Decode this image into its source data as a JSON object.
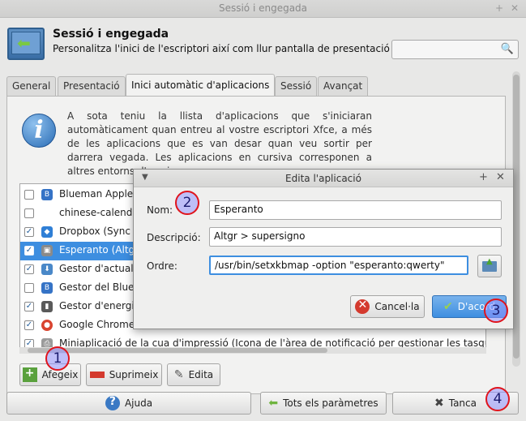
{
  "window": {
    "title": "Sessió i engegada"
  },
  "header": {
    "title": "Sessió i engegada",
    "subtitle": "Personalitza l'inici de l'escriptori així com llur pantalla de presentació",
    "search_placeholder": ""
  },
  "tabs": [
    {
      "label": "General"
    },
    {
      "label": "Presentació"
    },
    {
      "label": "Inici automàtic d'aplicacions"
    },
    {
      "label": "Sessió"
    },
    {
      "label": "Avançat"
    }
  ],
  "info_text": "A sota teniu la llista d'aplicacions que s'iniciaran automàticament quan entreu al vostre escriptori Xfce, a més de les aplicacions que es van desar quan veu sortir per darrera vegada. Les aplicacions en cursiva corresponen a altres entorns d'escri",
  "apps": [
    {
      "name": "Blueman Applet",
      "checked": false
    },
    {
      "name": "chinese-calenda",
      "checked": false
    },
    {
      "name": "Dropbox (Sync",
      "checked": true
    },
    {
      "name": "Esperanto (Altg",
      "checked": true,
      "selected": true
    },
    {
      "name": "Gestor d'actual",
      "checked": true
    },
    {
      "name": "Gestor del Blue",
      "checked": false
    },
    {
      "name": "Gestor d'energi",
      "checked": true
    },
    {
      "name": "Google Chrome",
      "checked": true
    },
    {
      "name": "Miniaplicació de la cua d'impressió (Icona de l'àrea de notificació per gestionar les tasque",
      "checked": true
    }
  ],
  "list_buttons": {
    "add": "Afegeix",
    "remove": "Suprimeix",
    "edit": "Edita"
  },
  "bottom_buttons": {
    "help": "Ajuda",
    "all_settings": "Tots els paràmetres",
    "close": "Tanca"
  },
  "dialog": {
    "title": "Edita l'aplicació",
    "name_label": "Nom:",
    "name_value": "Esperanto",
    "desc_label": "Descripció:",
    "desc_value": "Altgr > supersigno",
    "cmd_label": "Ordre:",
    "cmd_value": "/usr/bin/setxkbmap -option \"esperanto:qwerty\"",
    "cancel": "Cancel·la",
    "ok": "D'acord"
  },
  "markers": [
    "1",
    "2",
    "3",
    "4"
  ]
}
